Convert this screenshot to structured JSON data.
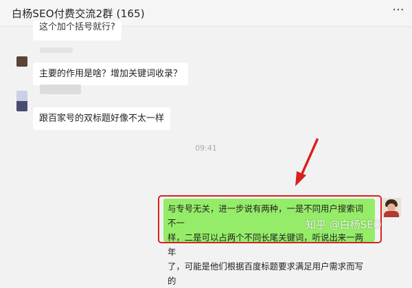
{
  "header": {
    "title": "白杨SEO付费交流2群 (165)",
    "more_icon": "more-dots-icon"
  },
  "messages": [
    {
      "side": "left",
      "text": "这个加个括号就行?"
    },
    {
      "side": "left",
      "text": "主要的作用是啥？增加关键词收录？"
    },
    {
      "side": "left",
      "text": "跟百家号的双标题好像不太一样"
    },
    {
      "side": "right",
      "text": "与专号无关，进一步说有两种，一是不同用户搜索词不一\n样，二是可以占两个不同长尾关键词，听说出来一两年\n了，可能是他们根据百度标题要求满足用户需求而写的"
    }
  ],
  "timestamp": "09:41",
  "watermark": "知乎 @白杨SEO",
  "colors": {
    "my_bubble": "#95ec69",
    "highlight_box": "#d8201f",
    "annotation_arrow": "#d8201f"
  }
}
